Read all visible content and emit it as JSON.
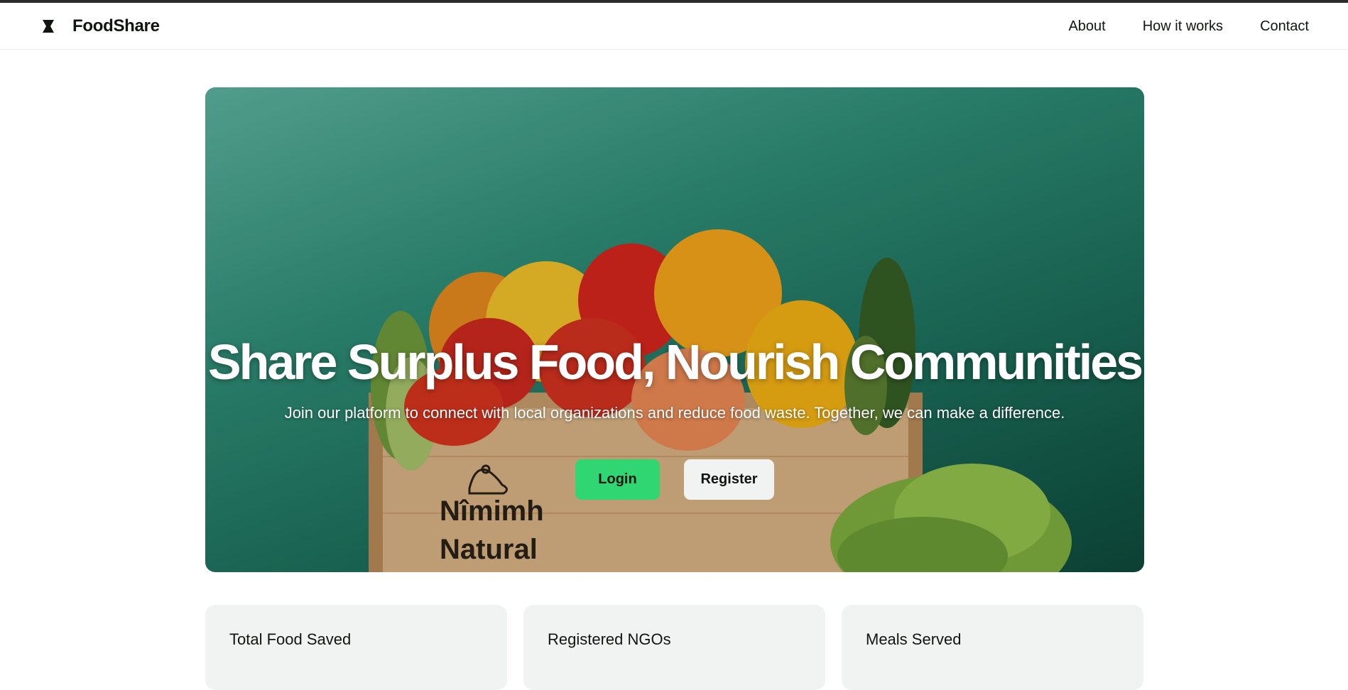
{
  "app": {
    "name": "FoodShare",
    "logo_icon": "foodshare-logo-icon"
  },
  "nav": {
    "items": [
      {
        "label": "About"
      },
      {
        "label": "How it works"
      },
      {
        "label": "Contact"
      }
    ]
  },
  "hero": {
    "title": "Share Surplus Food, Nourish Communities",
    "subtitle": "Join our platform to connect with local organizations and reduce food waste. Together, we can make a difference.",
    "login_label": "Login",
    "register_label": "Register",
    "crate_text_line1": "Nîmimh",
    "crate_text_line2": "Natural"
  },
  "stats": [
    {
      "label": "Total Food Saved"
    },
    {
      "label": "Registered NGOs"
    },
    {
      "label": "Meals Served"
    }
  ],
  "colors": {
    "accent": "#2fd672",
    "hero_teal": "#1c6e5b",
    "card_bg": "#f0f3f2",
    "text": "#111511"
  }
}
